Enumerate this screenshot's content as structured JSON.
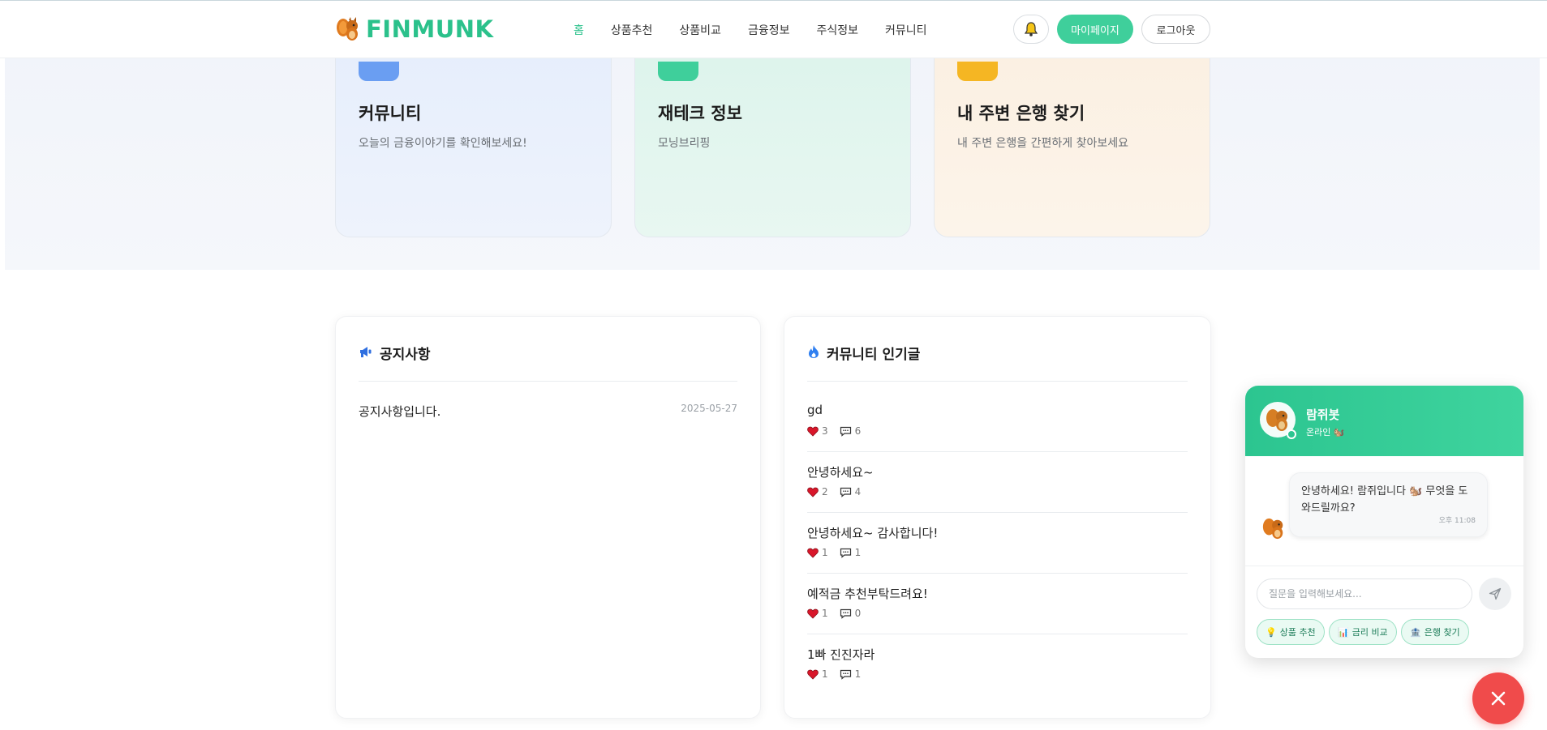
{
  "brand": {
    "name": "FINMUNK",
    "color": "#2bc18b"
  },
  "nav": {
    "items": [
      {
        "label": "홈",
        "active": true
      },
      {
        "label": "상품추천"
      },
      {
        "label": "상품비교"
      },
      {
        "label": "금융정보"
      },
      {
        "label": "주식정보"
      },
      {
        "label": "커뮤니티"
      }
    ]
  },
  "header": {
    "bell_icon": "bell-icon",
    "mypage_label": "마이페이지",
    "logout_label": "로그아웃"
  },
  "cards": [
    {
      "title": "커뮤니티",
      "desc": "오늘의 금융이야기를 확인해보세요!"
    },
    {
      "title": "재테크 정보",
      "desc": "모닝브리핑"
    },
    {
      "title": "내 주변 은행 찾기",
      "desc": "내 주변 은행을 간편하게 찾아보세요"
    }
  ],
  "notice": {
    "title": "공지사항",
    "icon": "megaphone-icon",
    "items": [
      {
        "text": "공지사항입니다.",
        "date": "2025-05-27"
      }
    ]
  },
  "popular": {
    "title": "커뮤니티 인기글",
    "icon": "fire-icon",
    "posts": [
      {
        "title": "gd",
        "likes": "3",
        "comments": "6"
      },
      {
        "title": "안녕하세요~",
        "likes": "2",
        "comments": "4"
      },
      {
        "title": "안녕하세요~ 감사합니다!",
        "likes": "1",
        "comments": "1"
      },
      {
        "title": "예적금 추천부탁드려요!",
        "likes": "1",
        "comments": "0"
      },
      {
        "title": "1빠 진진자라",
        "likes": "1",
        "comments": "1"
      }
    ]
  },
  "chat": {
    "name": "람쥐봇",
    "status": "온라인 🐿️",
    "message": "안녕하세요! 람쥐입니다 🐿️ 무엇을 도와드릴까요?",
    "time": "오후 11:08",
    "input_placeholder": "질문을 입력해보세요...",
    "quick_replies": [
      {
        "icon": "💡",
        "label": "상품 추천"
      },
      {
        "icon": "📊",
        "label": "금리 비교"
      },
      {
        "icon": "🏦",
        "label": "은행 찾기"
      }
    ]
  }
}
